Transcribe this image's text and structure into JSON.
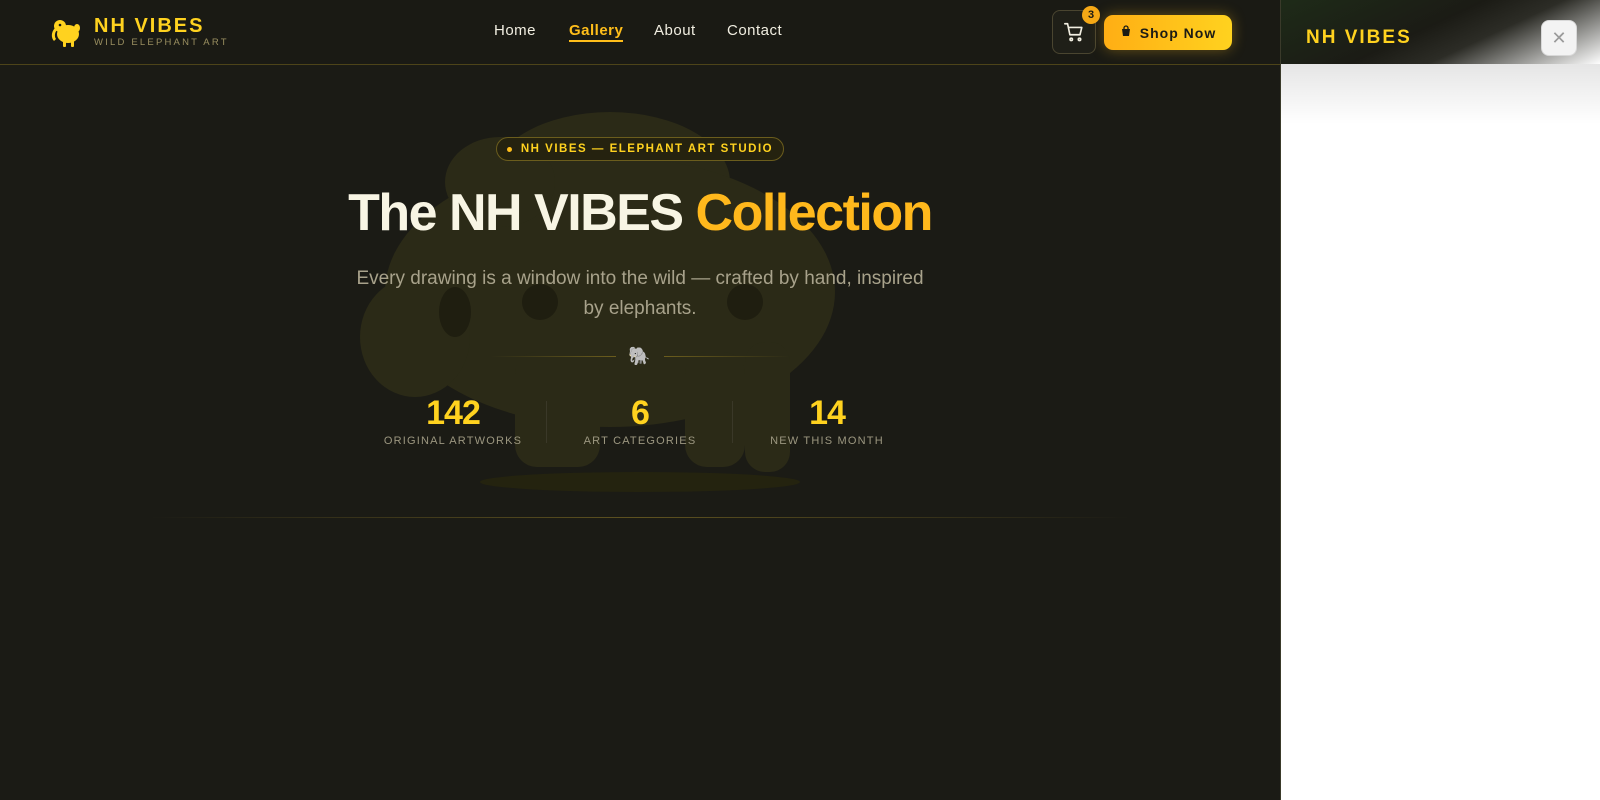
{
  "header": {
    "brand": "NH VIBES",
    "brand_sub": "WILD ELEPHANT ART",
    "logo_icon": "elephant-icon",
    "nav": [
      {
        "label": "Home",
        "active": false
      },
      {
        "label": "Gallery",
        "active": true
      },
      {
        "label": "About",
        "active": false
      },
      {
        "label": "Contact",
        "active": false
      }
    ],
    "cart_icon": "cart-icon",
    "cart_count": "3",
    "shop_icon": "bag-icon",
    "shop_label": "Shop Now"
  },
  "hero": {
    "pill": "NH VIBES — ELEPHANT ART STUDIO",
    "title_main": "The NH VIBES ",
    "title_accent": "Collection",
    "subtitle": "Every drawing is a window into the wild — crafted by hand, inspired by elephants.",
    "divider_icon": "🐘",
    "stats": [
      {
        "value": "142",
        "label": "ORIGINAL ARTWORKS"
      },
      {
        "value": "6",
        "label": "ART CATEGORIES"
      },
      {
        "value": "14",
        "label": "NEW THIS MONTH"
      }
    ]
  },
  "panel": {
    "title": "NH VIBES",
    "close_icon": "close-icon",
    "close_glyph": "✕"
  },
  "colors": {
    "accent": "#ffd21f",
    "accent_orange": "#ffb81c",
    "background": "#1b1b15",
    "panel_bg": "#ffffff"
  }
}
